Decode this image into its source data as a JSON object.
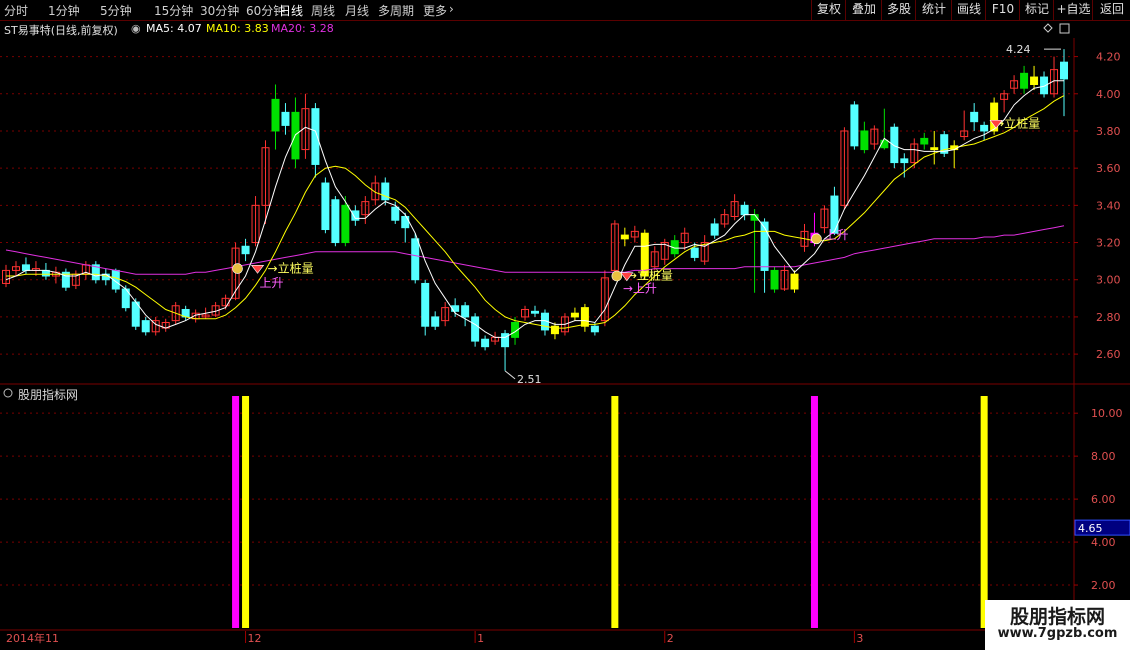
{
  "toolbar": {
    "timeframes": [
      "分时",
      "1分钟",
      "5分钟",
      "15分钟",
      "30分钟",
      "60分钟",
      "日线",
      "周线",
      "月线",
      "多周期",
      "更多"
    ],
    "active_timeframe": "日线",
    "right_buttons": [
      "复权",
      "叠加",
      "多股",
      "统计",
      "画线",
      "F10",
      "标记",
      "+自选",
      "返回"
    ]
  },
  "info": {
    "stock": "ST易事特(日线,前复权)",
    "ma5_label": "MA5: 4.07",
    "ma10_label": "MA10: 3.83",
    "ma20_label": "MA20: 3.28"
  },
  "colors": {
    "up": "#ff3232",
    "down": "#54ffff",
    "yellow": "#ffff00",
    "green": "#00e000",
    "magenta": "#ff00ff",
    "ma5": "#ffffff",
    "ma10": "#ffff00",
    "ma20": "#e030e0",
    "grid": "#7a0000"
  },
  "price_axis": {
    "labels": [
      "4.20",
      "4.00",
      "3.80",
      "3.60",
      "3.40",
      "3.20",
      "3.00",
      "2.80",
      "2.60"
    ]
  },
  "indicator_axis": {
    "labels": [
      "10.00",
      "8.00",
      "6.00",
      "4.00",
      "2.00"
    ],
    "current": "4.65"
  },
  "indicator": {
    "title": "股朋指标网"
  },
  "annotations": {
    "high": "4.24",
    "low": "2.51",
    "signals": [
      "→立桩量",
      "上升",
      "→立桩量",
      "→上升",
      "上升",
      "→立桩量"
    ]
  },
  "date_axis": {
    "labels": [
      "2014年11",
      "12",
      "1",
      "2",
      "3"
    ]
  },
  "watermark": {
    "line1": "股朋指标网",
    "line2": "www.7gpzb.com"
  },
  "chart_data": {
    "type": "candlestick",
    "price_range": [
      2.45,
      4.3
    ],
    "indicator_range": [
      0,
      10.8
    ],
    "candles": [
      [
        2.98,
        3.05,
        3.08,
        2.96
      ],
      [
        3.05,
        3.07,
        3.1,
        3.02
      ],
      [
        3.08,
        3.05,
        3.12,
        3.03
      ],
      [
        3.05,
        3.06,
        3.1,
        3.02
      ],
      [
        3.05,
        3.02,
        3.09,
        3.0
      ],
      [
        3.02,
        3.04,
        3.07,
        2.98
      ],
      [
        3.04,
        2.96,
        3.06,
        2.94
      ],
      [
        2.97,
        3.03,
        3.05,
        2.95
      ],
      [
        3.03,
        3.08,
        3.1,
        3.0
      ],
      [
        3.08,
        3.0,
        3.1,
        2.98
      ],
      [
        3.03,
        3.0,
        3.06,
        2.97
      ],
      [
        3.05,
        2.95,
        3.06,
        2.93
      ],
      [
        2.95,
        2.85,
        2.97,
        2.83
      ],
      [
        2.88,
        2.75,
        2.9,
        2.73
      ],
      [
        2.78,
        2.72,
        2.8,
        2.7
      ],
      [
        2.72,
        2.78,
        2.8,
        2.7
      ],
      [
        2.74,
        2.77,
        2.79,
        2.72
      ],
      [
        2.78,
        2.86,
        2.88,
        2.76
      ],
      [
        2.84,
        2.8,
        2.86,
        2.78
      ],
      [
        2.79,
        2.82,
        2.84,
        2.77
      ],
      [
        2.8,
        2.81,
        2.85,
        2.79
      ],
      [
        2.81,
        2.86,
        2.88,
        2.8
      ],
      [
        2.86,
        2.9,
        2.92,
        2.84
      ],
      [
        2.9,
        3.17,
        3.2,
        2.89
      ],
      [
        3.18,
        3.14,
        3.22,
        3.1
      ],
      [
        3.2,
        3.4,
        3.45,
        3.18
      ],
      [
        3.4,
        3.71,
        3.75,
        3.3
      ],
      [
        3.8,
        3.97,
        4.05,
        3.7
      ],
      [
        3.9,
        3.83,
        3.95,
        3.78
      ],
      [
        3.9,
        3.65,
        3.98,
        3.6
      ],
      [
        3.7,
        3.92,
        4.0,
        3.65
      ],
      [
        3.92,
        3.62,
        3.95,
        3.55
      ],
      [
        3.52,
        3.27,
        3.55,
        3.25
      ],
      [
        3.43,
        3.2,
        3.45,
        3.18
      ],
      [
        3.2,
        3.4,
        3.45,
        3.18
      ],
      [
        3.37,
        3.32,
        3.4,
        3.29
      ],
      [
        3.35,
        3.42,
        3.45,
        3.3
      ],
      [
        3.43,
        3.52,
        3.56,
        3.4
      ],
      [
        3.52,
        3.43,
        3.55,
        3.4
      ],
      [
        3.39,
        3.32,
        3.42,
        3.3
      ],
      [
        3.34,
        3.28,
        3.36,
        3.2
      ],
      [
        3.22,
        3.0,
        3.25,
        2.98
      ],
      [
        2.98,
        2.75,
        3.0,
        2.7
      ],
      [
        2.8,
        2.75,
        2.83,
        2.73
      ],
      [
        2.78,
        2.85,
        2.88,
        2.75
      ],
      [
        2.86,
        2.83,
        2.9,
        2.8
      ],
      [
        2.86,
        2.8,
        2.88,
        2.75
      ],
      [
        2.8,
        2.67,
        2.82,
        2.64
      ],
      [
        2.68,
        2.64,
        2.7,
        2.62
      ],
      [
        2.67,
        2.69,
        2.72,
        2.65
      ],
      [
        2.71,
        2.64,
        2.73,
        2.51
      ],
      [
        2.69,
        2.77,
        2.8,
        2.65
      ],
      [
        2.8,
        2.84,
        2.86,
        2.78
      ],
      [
        2.83,
        2.82,
        2.86,
        2.8
      ],
      [
        2.82,
        2.73,
        2.84,
        2.7
      ],
      [
        2.75,
        2.71,
        2.77,
        2.68
      ],
      [
        2.72,
        2.8,
        2.82,
        2.7
      ],
      [
        2.8,
        2.82,
        2.85,
        2.78
      ],
      [
        2.85,
        2.75,
        2.87,
        2.72
      ],
      [
        2.75,
        2.72,
        2.77,
        2.7
      ],
      [
        2.78,
        3.01,
        3.05,
        2.75
      ],
      [
        3.05,
        3.3,
        3.32,
        3.0
      ],
      [
        3.22,
        3.24,
        3.28,
        3.18
      ],
      [
        3.23,
        3.26,
        3.29,
        3.2
      ],
      [
        3.25,
        3.02,
        3.27,
        3.0
      ],
      [
        3.07,
        3.15,
        3.18,
        3.05
      ],
      [
        3.11,
        3.2,
        3.22,
        3.08
      ],
      [
        3.21,
        3.14,
        3.24,
        3.12
      ],
      [
        3.2,
        3.25,
        3.28,
        3.16
      ],
      [
        3.17,
        3.12,
        3.2,
        3.1
      ],
      [
        3.1,
        3.2,
        3.24,
        3.08
      ],
      [
        3.3,
        3.24,
        3.33,
        3.22
      ],
      [
        3.3,
        3.35,
        3.38,
        3.28
      ],
      [
        3.34,
        3.42,
        3.46,
        3.32
      ],
      [
        3.4,
        3.35,
        3.42,
        3.32
      ],
      [
        3.35,
        3.32,
        3.38,
        2.93
      ],
      [
        3.31,
        3.05,
        3.33,
        2.93
      ],
      [
        3.05,
        2.95,
        3.07,
        2.93
      ],
      [
        2.95,
        3.05,
        3.08,
        2.94
      ],
      [
        2.95,
        3.03,
        3.05,
        2.93
      ],
      [
        3.18,
        3.26,
        3.3,
        3.15
      ],
      [
        3.25,
        3.2,
        3.36,
        3.18
      ],
      [
        3.28,
        3.38,
        3.4,
        3.25
      ],
      [
        3.45,
        3.25,
        3.5,
        3.24
      ],
      [
        3.4,
        3.8,
        3.82,
        3.38
      ],
      [
        3.94,
        3.72,
        3.96,
        3.7
      ],
      [
        3.8,
        3.7,
        3.85,
        3.68
      ],
      [
        3.73,
        3.81,
        3.83,
        3.7
      ],
      [
        3.71,
        3.75,
        3.92,
        3.7
      ],
      [
        3.82,
        3.63,
        3.84,
        3.6
      ],
      [
        3.65,
        3.63,
        3.68,
        3.55
      ],
      [
        3.63,
        3.73,
        3.76,
        3.6
      ],
      [
        3.73,
        3.76,
        3.79,
        3.7
      ],
      [
        3.71,
        3.7,
        3.8,
        3.62
      ],
      [
        3.78,
        3.68,
        3.8,
        3.66
      ],
      [
        3.7,
        3.72,
        3.75,
        3.6
      ],
      [
        3.77,
        3.8,
        3.91,
        3.75
      ],
      [
        3.9,
        3.85,
        3.95,
        3.8
      ],
      [
        3.83,
        3.8,
        3.85,
        3.75
      ],
      [
        3.8,
        3.95,
        3.98,
        3.78
      ],
      [
        3.97,
        4.0,
        4.02,
        3.9
      ],
      [
        4.03,
        4.07,
        4.1,
        4.0
      ],
      [
        4.11,
        4.03,
        4.15,
        4.0
      ],
      [
        4.09,
        4.05,
        4.15,
        4.02
      ],
      [
        4.09,
        4.0,
        4.12,
        3.98
      ],
      [
        4.0,
        4.13,
        4.2,
        3.98
      ],
      [
        4.17,
        4.08,
        4.24,
        3.88
      ]
    ],
    "ma5": [
      3.0,
      3.02,
      3.05,
      3.05,
      3.05,
      3.04,
      3.02,
      3.02,
      3.04,
      3.02,
      3.03,
      2.99,
      2.95,
      2.88,
      2.81,
      2.76,
      2.74,
      2.76,
      2.78,
      2.81,
      2.82,
      2.83,
      2.85,
      2.94,
      3.02,
      3.15,
      3.32,
      3.5,
      3.66,
      3.78,
      3.82,
      3.8,
      3.64,
      3.5,
      3.42,
      3.33,
      3.33,
      3.38,
      3.42,
      3.4,
      3.35,
      3.25,
      3.1,
      2.98,
      2.9,
      2.82,
      2.79,
      2.76,
      2.72,
      2.69,
      2.69,
      2.72,
      2.76,
      2.78,
      2.78,
      2.76,
      2.76,
      2.78,
      2.78,
      2.77,
      2.84,
      2.96,
      3.08,
      3.18,
      3.18,
      3.19,
      3.19,
      3.17,
      3.17,
      3.19,
      3.18,
      3.21,
      3.24,
      3.3,
      3.35,
      3.35,
      3.28,
      3.18,
      3.11,
      3.04,
      3.09,
      3.14,
      3.22,
      3.26,
      3.38,
      3.47,
      3.56,
      3.66,
      3.76,
      3.72,
      3.7,
      3.7,
      3.69,
      3.69,
      3.69,
      3.7,
      3.73,
      3.76,
      3.78,
      3.81,
      3.86,
      3.94,
      3.99,
      4.03,
      4.04,
      4.07,
      4.07
    ],
    "ma10": [
      3.02,
      3.02,
      3.03,
      3.03,
      3.03,
      3.03,
      3.03,
      3.03,
      3.03,
      3.03,
      3.02,
      3.01,
      2.99,
      2.96,
      2.92,
      2.88,
      2.84,
      2.82,
      2.8,
      2.79,
      2.79,
      2.79,
      2.81,
      2.85,
      2.9,
      2.97,
      3.05,
      3.15,
      3.26,
      3.36,
      3.47,
      3.56,
      3.6,
      3.61,
      3.6,
      3.56,
      3.51,
      3.47,
      3.45,
      3.43,
      3.39,
      3.33,
      3.27,
      3.21,
      3.15,
      3.08,
      3.02,
      2.96,
      2.89,
      2.84,
      2.8,
      2.78,
      2.77,
      2.76,
      2.75,
      2.74,
      2.74,
      2.75,
      2.76,
      2.76,
      2.77,
      2.81,
      2.86,
      2.92,
      2.97,
      3.02,
      3.07,
      3.11,
      3.15,
      3.18,
      3.19,
      3.2,
      3.21,
      3.23,
      3.24,
      3.26,
      3.26,
      3.26,
      3.24,
      3.23,
      3.22,
      3.21,
      3.21,
      3.22,
      3.26,
      3.31,
      3.36,
      3.42,
      3.48,
      3.54,
      3.58,
      3.62,
      3.66,
      3.68,
      3.7,
      3.71,
      3.72,
      3.73,
      3.75,
      3.77,
      3.79,
      3.82,
      3.86,
      3.89,
      3.92,
      3.96,
      3.99
    ],
    "ma20": [
      3.16,
      3.15,
      3.14,
      3.13,
      3.12,
      3.11,
      3.1,
      3.09,
      3.08,
      3.07,
      3.06,
      3.05,
      3.04,
      3.03,
      3.03,
      3.03,
      3.03,
      3.03,
      3.03,
      3.04,
      3.04,
      3.05,
      3.06,
      3.07,
      3.08,
      3.09,
      3.1,
      3.11,
      3.12,
      3.13,
      3.14,
      3.15,
      3.15,
      3.15,
      3.15,
      3.15,
      3.15,
      3.15,
      3.15,
      3.15,
      3.14,
      3.13,
      3.12,
      3.11,
      3.1,
      3.09,
      3.08,
      3.07,
      3.06,
      3.05,
      3.04,
      3.04,
      3.04,
      3.04,
      3.04,
      3.04,
      3.04,
      3.04,
      3.04,
      3.04,
      3.04,
      3.04,
      3.04,
      3.05,
      3.05,
      3.06,
      3.06,
      3.06,
      3.06,
      3.06,
      3.06,
      3.06,
      3.06,
      3.06,
      3.07,
      3.07,
      3.07,
      3.07,
      3.07,
      3.07,
      3.08,
      3.09,
      3.1,
      3.11,
      3.12,
      3.14,
      3.15,
      3.16,
      3.17,
      3.18,
      3.19,
      3.2,
      3.21,
      3.22,
      3.22,
      3.22,
      3.22,
      3.22,
      3.23,
      3.23,
      3.24,
      3.24,
      3.25,
      3.26,
      3.27,
      3.28,
      3.29
    ],
    "indicator_bars": [
      {
        "index": 23,
        "value": 10.8,
        "color": "magenta"
      },
      {
        "index": 24,
        "value": 10.8,
        "color": "yellow"
      },
      {
        "index": 61,
        "value": 10.8,
        "color": "yellow"
      },
      {
        "index": 81,
        "value": 10.8,
        "color": "magenta"
      },
      {
        "index": 98,
        "value": 10.8,
        "color": "yellow"
      }
    ]
  }
}
